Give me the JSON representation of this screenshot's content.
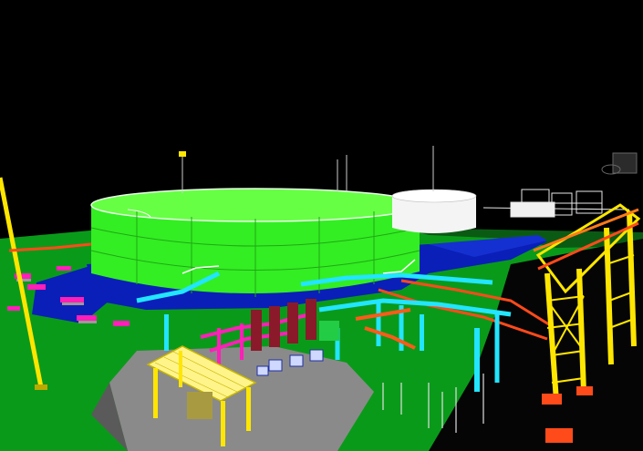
{
  "scene": {
    "kind": "3D plant design model render",
    "colors": {
      "background": "#000000",
      "ground": "#0a9a1a",
      "water": "#0a1fb8",
      "tank": "#33ee22",
      "white_tank": "#f4f4f4",
      "pipe_yellow": "#ffe600",
      "pipe_cyan": "#22e5ff",
      "pipe_orange": "#ff4a1a",
      "pipe_magenta": "#ff1fb8",
      "concrete": "#8a8a8a"
    }
  }
}
